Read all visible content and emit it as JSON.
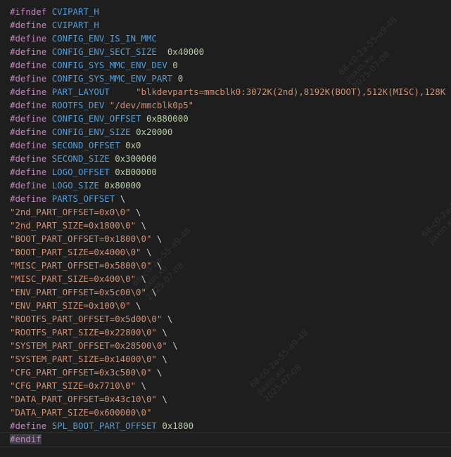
{
  "code": {
    "l1": {
      "kw": "#ifndef",
      "name": "CVIPART_H"
    },
    "l2": {
      "kw": "#define",
      "name": "CVIPART_H"
    },
    "l3": {
      "kw": "#define",
      "name": "CONFIG_ENV_IS_IN_MMC"
    },
    "l4": {
      "kw": "#define",
      "name": "CONFIG_ENV_SECT_SIZE",
      "value": "0x40000"
    },
    "l5": {
      "kw": "#define",
      "name": "CONFIG_SYS_MMC_ENV_DEV",
      "value": "0"
    },
    "l6": {
      "kw": "#define",
      "name": "CONFIG_SYS_MMC_ENV_PART",
      "value": "0"
    },
    "l7": {
      "kw": "#define",
      "name": "PART_LAYOUT",
      "value": "\"blkdevparts=mmcblk0:3072K(2nd),8192K(BOOT),512K(MISC),128K"
    },
    "l8": {
      "kw": "#define",
      "name": "ROOTFS_DEV",
      "value": "\"/dev/mmcblk0p5\""
    },
    "l9": {
      "kw": "#define",
      "name": "CONFIG_ENV_OFFSET",
      "value": "0xB80000"
    },
    "l10": {
      "kw": "#define",
      "name": "CONFIG_ENV_SIZE",
      "value": "0x20000"
    },
    "l11": {
      "kw": "#define",
      "name": "SECOND_OFFSET",
      "value": "0x0"
    },
    "l12": {
      "kw": "#define",
      "name": "SECOND_SIZE",
      "value": "0x300000"
    },
    "l13": {
      "kw": "#define",
      "name": "LOGO_OFFSET",
      "value": "0xB00000"
    },
    "l14": {
      "kw": "#define",
      "name": "LOGO_SIZE",
      "value": "0x80000"
    },
    "l15": {
      "kw": "#define",
      "name": "PARTS_OFFSET",
      "cont": "\\"
    },
    "l16": {
      "str": "\"2nd_PART_OFFSET=0x0\\0\"",
      "cont": "\\"
    },
    "l17": {
      "str": "\"2nd_PART_SIZE=0x1800\\0\"",
      "cont": "\\"
    },
    "l18": {
      "str": "\"BOOT_PART_OFFSET=0x1800\\0\"",
      "cont": "\\"
    },
    "l19": {
      "str": "\"BOOT_PART_SIZE=0x4000\\0\"",
      "cont": "\\"
    },
    "l20": {
      "str": "\"MISC_PART_OFFSET=0x5800\\0\"",
      "cont": "\\"
    },
    "l21": {
      "str": "\"MISC_PART_SIZE=0x400\\0\"",
      "cont": "\\"
    },
    "l22": {
      "str": "\"ENV_PART_OFFSET=0x5c00\\0\"",
      "cont": "\\"
    },
    "l23": {
      "str": "\"ENV_PART_SIZE=0x100\\0\"",
      "cont": "\\"
    },
    "l24": {
      "str": "\"ROOTFS_PART_OFFSET=0x5d00\\0\"",
      "cont": "\\"
    },
    "l25": {
      "str": "\"ROOTFS_PART_SIZE=0x22800\\0\"",
      "cont": "\\"
    },
    "l26": {
      "str": "\"SYSTEM_PART_OFFSET=0x28500\\0\"",
      "cont": "\\"
    },
    "l27": {
      "str": "\"SYSTEM_PART_SIZE=0x14000\\0\"",
      "cont": "\\"
    },
    "l28": {
      "str": "\"CFG_PART_OFFSET=0x3c500\\0\"",
      "cont": "\\"
    },
    "l29": {
      "str": "\"CFG_PART_SIZE=0x7710\\0\"",
      "cont": "\\"
    },
    "l30": {
      "str": "\"DATA_PART_OFFSET=0x43c10\\0\"",
      "cont": "\\"
    },
    "l31": {
      "str": "\"DATA_PART_SIZE=0x600000\\0\""
    },
    "l32": {
      "kw": "#define",
      "name": "SPL_BOOT_PART_OFFSET",
      "value": "0x1800"
    },
    "l33": {
      "kw": "#endif"
    }
  },
  "watermark": {
    "line1": "68-c0-2a-55-a9-48",
    "line2": "jiaxin.xu",
    "line3": "2025-07-08"
  },
  "colors": {
    "background": "#1e1e1e",
    "preprocessor": "#c586c0",
    "macro": "#569cd6",
    "string": "#ce9178",
    "number": "#b5cea8"
  }
}
